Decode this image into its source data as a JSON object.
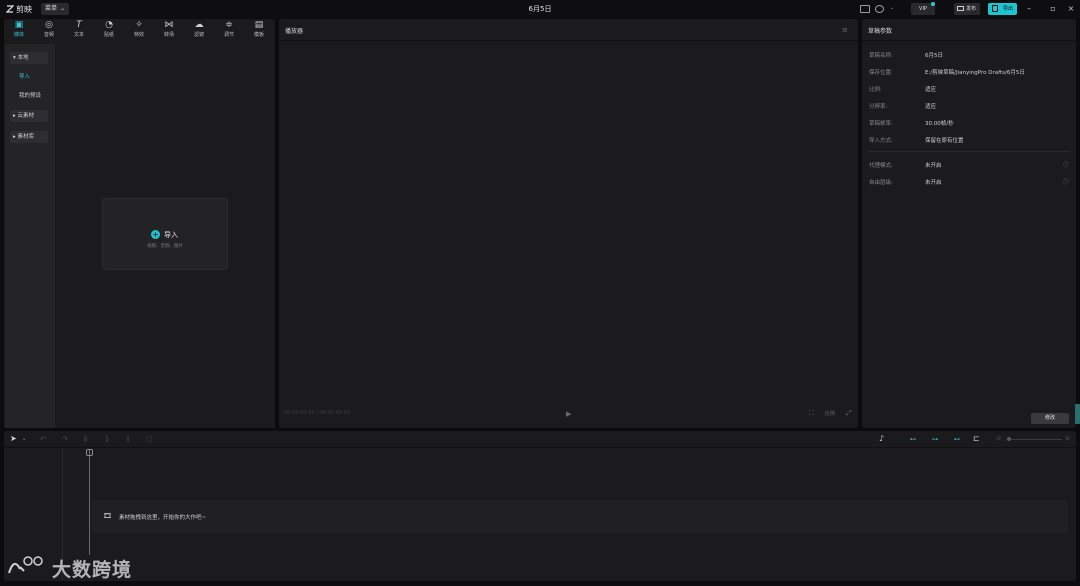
{
  "titlebar": {
    "app_name": "剪映",
    "menu_label": "菜单",
    "window_title": "6月5日",
    "vip_label": "VIP",
    "publish_label": "发布",
    "export_label": "导出"
  },
  "media": {
    "tools": [
      {
        "label": "媒体",
        "icon": "media-icon"
      },
      {
        "label": "音频",
        "icon": "audio-icon"
      },
      {
        "label": "文本",
        "icon": "text-icon"
      },
      {
        "label": "贴纸",
        "icon": "sticker-icon"
      },
      {
        "label": "特效",
        "icon": "effects-icon"
      },
      {
        "label": "转场",
        "icon": "transition-icon"
      },
      {
        "label": "滤镜",
        "icon": "filter-icon"
      },
      {
        "label": "调节",
        "icon": "adjust-icon"
      },
      {
        "label": "模板",
        "icon": "template-icon"
      }
    ],
    "sidebar": {
      "local": "本地",
      "import": "导入",
      "my_presets": "我的预设",
      "cloud": "云素材",
      "library": "素材库"
    },
    "import_label": "导入",
    "import_hint": "视频、音频、图片"
  },
  "player": {
    "title": "播放器",
    "timecode": "00:00:00:00 / 00:00:00:00",
    "ratio_label": "比例"
  },
  "params": {
    "title": "草稿参数",
    "rows": [
      {
        "label": "草稿名称:",
        "value": "6月5日"
      },
      {
        "label": "保存位置:",
        "value": "E:/剪映草稿/JianyingPro Drafts/6月5日"
      },
      {
        "label": "比例:",
        "value": "适应"
      },
      {
        "label": "分辨率:",
        "value": "适应"
      },
      {
        "label": "草稿帧率:",
        "value": "30.00帧/秒"
      },
      {
        "label": "导入方式:",
        "value": "保留在原有位置"
      }
    ],
    "extra_rows": [
      {
        "label": "代理模式:",
        "value": "未开启"
      },
      {
        "label": "自由层级:",
        "value": "未开启"
      }
    ],
    "edit_label": "修改"
  },
  "timeline": {
    "drop_hint": "素材拖拽到这里，开始你的大作吧~"
  },
  "watermark": {
    "text": "大数跨境"
  }
}
